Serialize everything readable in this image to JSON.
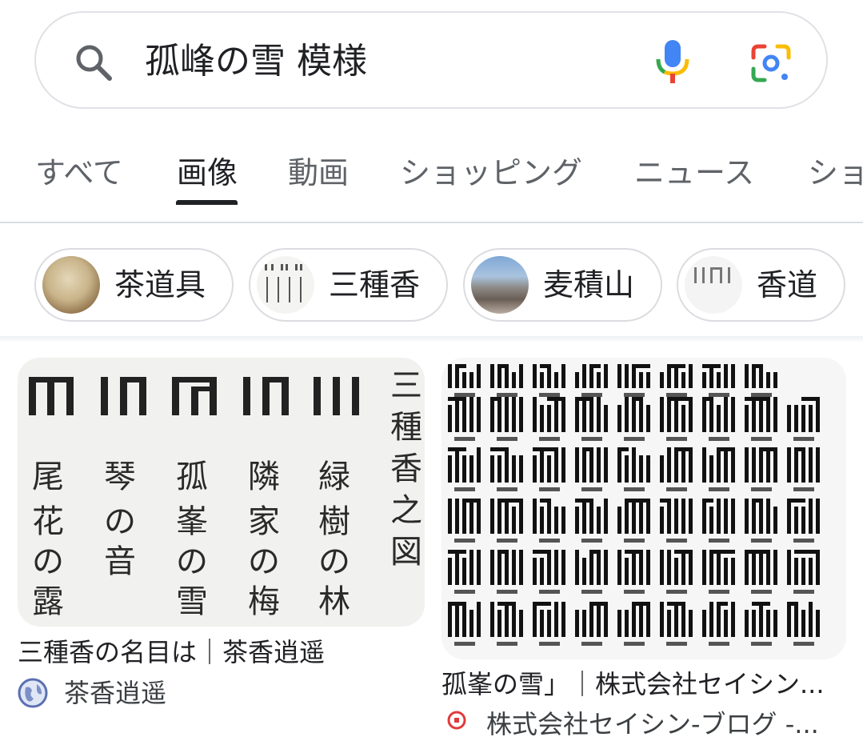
{
  "search": {
    "query": "孤峰の雪 模様",
    "icons": {
      "search": "search-icon",
      "voice": "mic-icon",
      "lens": "google-lens-icon"
    }
  },
  "tabs": [
    {
      "label": "すべて",
      "active": false
    },
    {
      "label": "画像",
      "active": true
    },
    {
      "label": "動画",
      "active": false
    },
    {
      "label": "ショッピング",
      "active": false
    },
    {
      "label": "ニュース",
      "active": false
    },
    {
      "label": "ショ",
      "active": false
    }
  ],
  "chips": [
    {
      "label": "茶道具"
    },
    {
      "label": "三種香"
    },
    {
      "label": "麦積山"
    },
    {
      "label": "香道"
    }
  ],
  "results": [
    {
      "title": "三種香の名目は｜茶香逍遥",
      "source": "茶香逍遥",
      "image_text": {
        "heading": "三種香之図",
        "columns": [
          "緑樹の林",
          "隣家の梅",
          "孤峰の雪",
          "琴の音",
          "尾花の露"
        ]
      }
    },
    {
      "title": "孤峯の雪」｜株式会社セイシン...",
      "source": "株式会社セイシン-ブログ -..."
    }
  ],
  "colors": {
    "text": "#202124",
    "muted": "#5f6368",
    "border": "#dadce0",
    "google_blue": "#4285f4",
    "google_red": "#ea4335",
    "google_yellow": "#fbbc04",
    "google_green": "#34a853"
  }
}
